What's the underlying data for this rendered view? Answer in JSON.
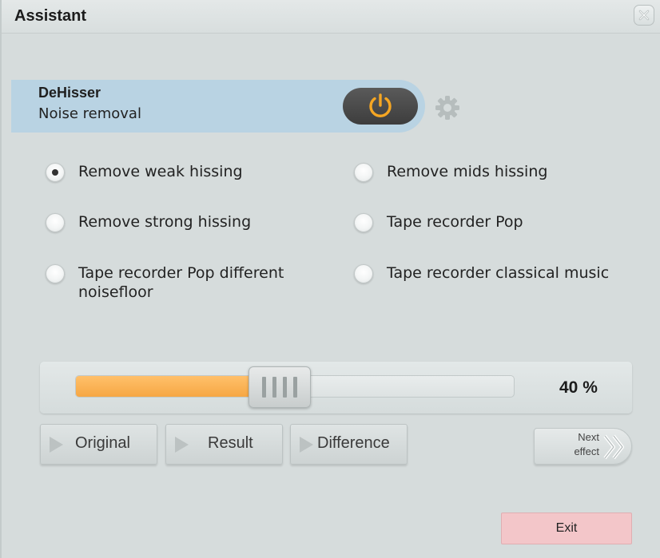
{
  "window": {
    "title": "Assistant"
  },
  "effect": {
    "name": "DeHisser",
    "description": "Noise removal",
    "power_on": true,
    "power_color": "#f5a623"
  },
  "presets": [
    {
      "label": "Remove weak hissing",
      "checked": true
    },
    {
      "label": "Remove mids hissing",
      "checked": false
    },
    {
      "label": "Remove strong hissing",
      "checked": false
    },
    {
      "label": "Tape recorder Pop",
      "checked": false
    },
    {
      "label": "Tape recorder Pop different noisefloor",
      "checked": false
    },
    {
      "label": "Tape recorder classical music",
      "checked": false
    }
  ],
  "slider": {
    "value_percent": 40,
    "value_label": "40 %"
  },
  "playback": {
    "original_label": "Original",
    "result_label": "Result",
    "difference_label": "Difference"
  },
  "next_effect": {
    "line1": "Next",
    "line2": "effect"
  },
  "exit_label": "Exit",
  "colors": {
    "slider_fill": "#f6a744",
    "exit_bg": "#f3c6c9",
    "header_bg": "#b9d3e3"
  }
}
